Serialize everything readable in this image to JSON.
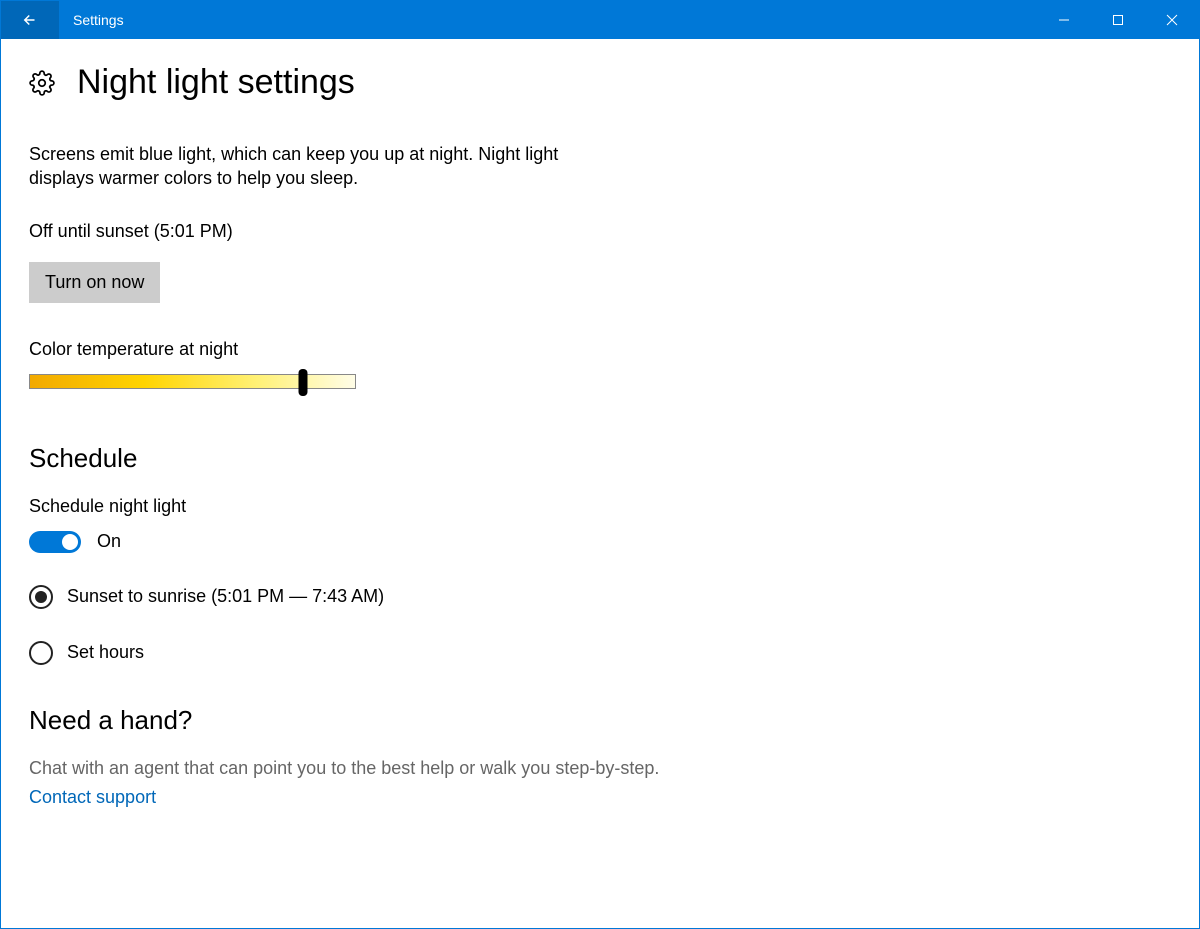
{
  "titlebar": {
    "title": "Settings"
  },
  "page": {
    "title": "Night light settings",
    "description": "Screens emit blue light, which can keep you up at night. Night light displays warmer colors to help you sleep.",
    "status": "Off until sunset (5:01 PM)",
    "turn_on_label": "Turn on now",
    "temperature_label": "Color temperature at night",
    "slider_percent": 84
  },
  "schedule": {
    "heading": "Schedule",
    "toggle_label": "Schedule night light",
    "toggle_state_label": "On",
    "radio_sunset": "Sunset to sunrise (5:01 PM — 7:43 AM)",
    "radio_set_hours": "Set hours"
  },
  "help": {
    "heading": "Need a hand?",
    "description": "Chat with an agent that can point you to the best help or walk you step-by-step.",
    "link": "Contact support"
  }
}
